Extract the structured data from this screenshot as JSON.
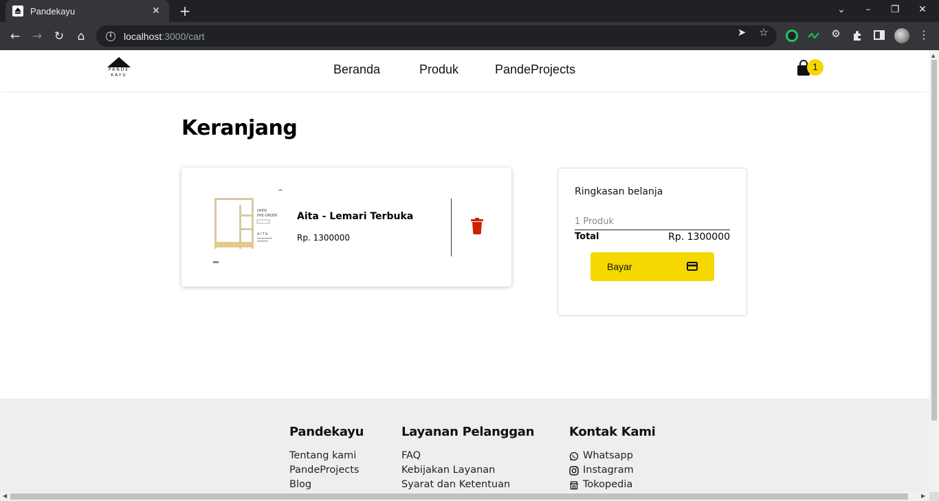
{
  "browser": {
    "tab_title": "Pandekayu",
    "tab_close": "✕",
    "new_tab": "+",
    "url_host": "localhost",
    "url_path": ":3000/cart"
  },
  "header": {
    "logo_line1": "PANDE",
    "logo_line2": "KAYU",
    "nav": [
      "Beranda",
      "Produk",
      "PandeProjects"
    ],
    "cart_count": "1"
  },
  "page": {
    "title": "Keranjang"
  },
  "cart": {
    "items": [
      {
        "name": "Aita - Lemari Terbuka",
        "price": "Rp. 1300000",
        "img_text_open": "OPEN",
        "img_text_pre": "PRE-ORDER",
        "img_text_name": "AITA"
      }
    ]
  },
  "summary": {
    "title": "Ringkasan belanja",
    "count": "1 Produk",
    "total_label": "Total",
    "total_value": "Rp. 1300000",
    "pay_label": "Bayar"
  },
  "footer": {
    "col1": {
      "title": "Pandekayu",
      "links": [
        "Tentang kami",
        "PandeProjects",
        "Blog"
      ]
    },
    "col2": {
      "title": "Layanan Pelanggan",
      "links": [
        "FAQ",
        "Kebijakan Layanan",
        "Syarat dan Ketentuan"
      ]
    },
    "col3": {
      "title": "Kontak Kami",
      "links": [
        "Whatsapp",
        "Instagram",
        "Tokopedia"
      ]
    }
  },
  "colors": {
    "accent": "#f5d800",
    "trash": "#cc2200",
    "footer_bg": "#eceef0"
  }
}
